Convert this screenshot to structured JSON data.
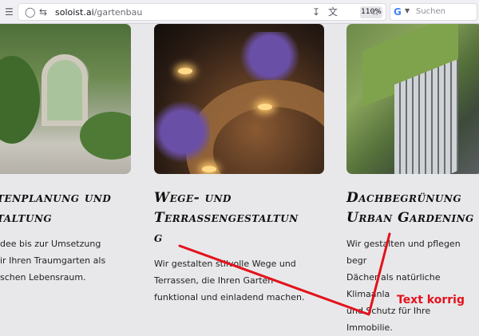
{
  "browser": {
    "url_host": "soloist.ai",
    "url_path": "/gartenbau",
    "zoom": "110%",
    "search_placeholder": "Suchen"
  },
  "cards": [
    {
      "title_line1": "tenplanung und",
      "title_line2": "taltung",
      "body_line1": "dee bis zur Umsetzung",
      "body_line2": "ir Ihren Traumgarten als",
      "body_line3": "schen Lebensraum."
    },
    {
      "title_line1": "Wege- und",
      "title_line2": "Terrassengestaltun",
      "title_line3": "g",
      "body_line1": "Wir gestalten stilvolle Wege und",
      "body_line2": "Terrassen, die Ihren Garten",
      "body_line3": "funktional und einladend machen."
    },
    {
      "title_line1": "Dachbegrünung",
      "title_line2": "Urban Gardening",
      "body_line1": "Wir gestalten und pflegen begr",
      "body_line2": "Dächer als natürliche Klimaanla",
      "body_line3": "und Schutz für Ihre Immobilie."
    }
  ],
  "annotation": {
    "text": "Text korrig",
    "color": "#e3121c"
  }
}
